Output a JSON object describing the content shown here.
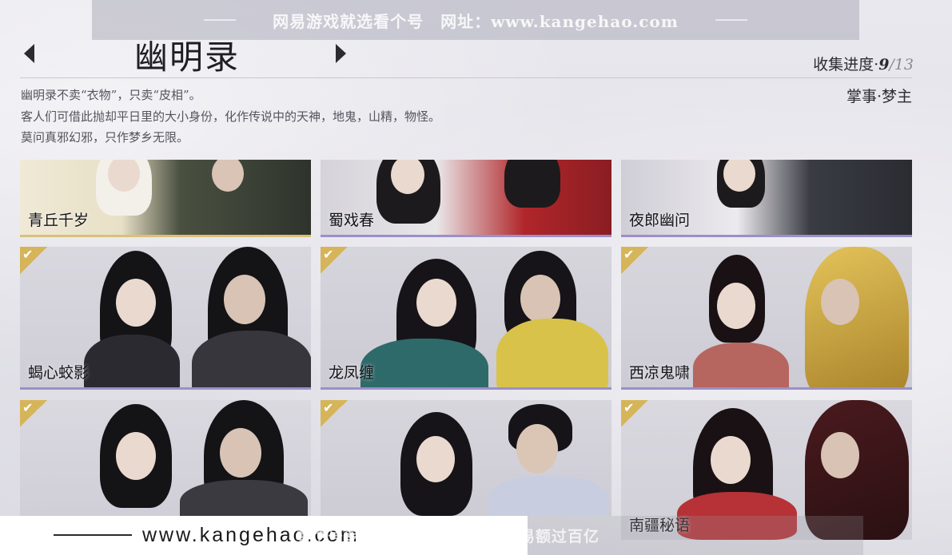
{
  "watermark_top": "网易游戏就选看个号　网址：www.kangehao.com",
  "header": {
    "title": "幽明录",
    "progress_label": "收集进度·",
    "progress_current": "9",
    "progress_total": "/13",
    "manager": "掌事·梦主"
  },
  "description": [
    "幽明录不卖“衣物”，只卖“皮相”。",
    "客人们可借此抛却平日里的大小身份，化作传说中的天神，地鬼，山精，物怪。",
    "莫问真邪幻邪，只作梦乡无限。"
  ],
  "cards": [
    {
      "name": "青丘千岁",
      "collected": false
    },
    {
      "name": "蜀戏春",
      "collected": false
    },
    {
      "name": "夜郎幽问",
      "collected": false
    },
    {
      "name": "蝎心蛟影",
      "collected": true
    },
    {
      "name": "龙凤缠",
      "collected": true
    },
    {
      "name": "西凉鬼啸",
      "collected": true
    },
    {
      "name": "",
      "collected": true
    },
    {
      "name": "",
      "collected": true
    },
    {
      "name": "南疆秘语",
      "collected": true
    }
  ],
  "bottom": {
    "url": "www.kangehao.com",
    "watermark": "看个号专业网易游戏八年　年交易额过百亿"
  },
  "icons": {
    "prev": "chevron-left-icon",
    "next": "chevron-right-icon",
    "check": "checkmark-icon"
  }
}
